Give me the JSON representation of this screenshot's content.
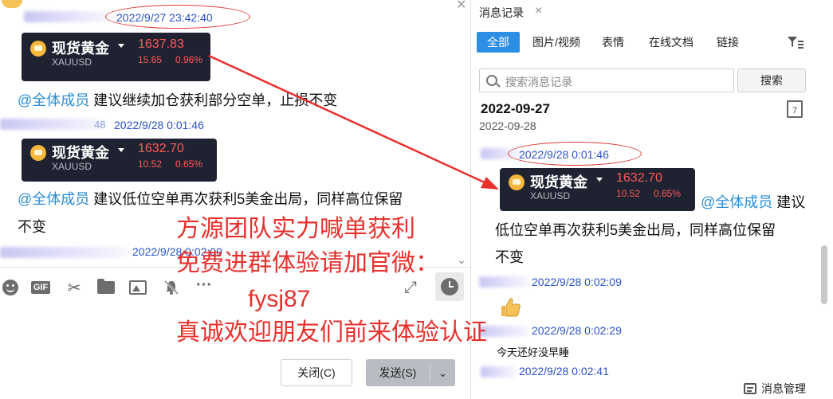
{
  "left_pane": {
    "msg1": {
      "timestamp": "2022/9/27 23:42:40"
    },
    "card1": {
      "name": "现货黄金",
      "code": "XAUUSD",
      "price": "1637.83",
      "change": "15.65",
      "pct": "0.96%"
    },
    "msg1_text": {
      "mention": "@全体成员",
      "body": " 建议继续加仓获利部分空单，止损不变"
    },
    "msg2": {
      "timestamp_partial": "48",
      "timestamp": "2022/9/28 0:01:46"
    },
    "card2": {
      "name": "现货黄金",
      "code": "XAUUSD",
      "price": "1632.70",
      "change": "10.52",
      "pct": "0.65%"
    },
    "msg2_text": {
      "mention": "@全体成员",
      "body": " 建议低位空单再次获利5美金出局，同样高位保留",
      "body2": "不变"
    },
    "msg3": {
      "timestamp": "2022/9/28 0:02:09"
    },
    "toolbar": {
      "gif_label": "GIF",
      "more_label": "···"
    },
    "close_button": "关闭(C)",
    "send_button": "发送(S)"
  },
  "overlay_text": {
    "line1": "方源团队实力喊单获利",
    "line2": "免费进群体验请加官微：",
    "line3": "fysj87",
    "line4": "真诚欢迎朋友们前来体验认证"
  },
  "right_pane": {
    "tab_title": "消息记录",
    "close_tab": "×",
    "filter_tabs": [
      "全部",
      "图片/视频",
      "表情",
      "在线文档",
      "链接"
    ],
    "search_placeholder": "搜索消息记录",
    "search_button": "搜索",
    "date_header": "2022-09-27",
    "date_sub": "2022-09-28",
    "calendar_day": "7",
    "rmsg1": {
      "timestamp": "2022/9/28 0:01:46"
    },
    "rcard": {
      "name": "现货黄金",
      "code": "XAUUSD",
      "price": "1632.70",
      "change": "10.52",
      "pct": "0.65%"
    },
    "rmsg1_text": {
      "mention": "@全体成员",
      "body": " 建议",
      "body2": "低位空单再次获利5美金出局，同样高位保留",
      "body3": "不变"
    },
    "rmsg2": {
      "timestamp": "2022/9/28 0:02:09"
    },
    "rmsg3": {
      "timestamp": "2022/9/28 0:02:29",
      "text": "今天还好没早睡"
    },
    "rmsg4": {
      "timestamp": "2022/9/28 0:02:41"
    },
    "manage_label": "消息管理"
  },
  "colors": {
    "accent": "#2d8ee6",
    "annotation_red": "#e23b35",
    "price_red": "#ff5a57",
    "card_bg": "#1f2230"
  }
}
